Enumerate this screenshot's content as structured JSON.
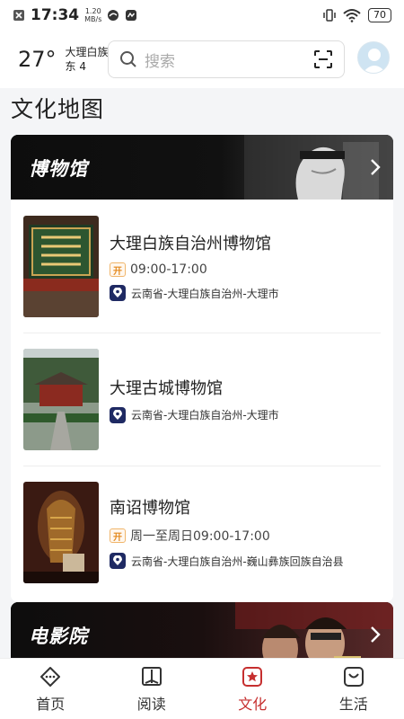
{
  "statusbar": {
    "time": "17:34",
    "net_speed_value": "1.20",
    "net_speed_unit": "MB/s",
    "battery": "70"
  },
  "header": {
    "temperature": "27°",
    "location": "大理白族自治州",
    "wind": "东 4",
    "search_placeholder": "搜索"
  },
  "page_title": "文化地图",
  "sections": [
    {
      "title": "博物馆",
      "items": [
        {
          "name": "大理白族自治州博物馆",
          "badge": "开",
          "hours": "09:00-17:00",
          "address": "云南省-大理白族自治州-大理市"
        },
        {
          "name": "大理古城博物馆",
          "address": "云南省-大理白族自治州-大理市"
        },
        {
          "name": "南诏博物馆",
          "badge": "开",
          "hours": "周一至周日09:00-17:00",
          "address": "云南省-大理白族自治州-巍山彝族回族自治县"
        }
      ]
    },
    {
      "title": "电影院"
    }
  ],
  "tabs": [
    {
      "label": "首页",
      "icon": "home-icon"
    },
    {
      "label": "阅读",
      "icon": "book-icon"
    },
    {
      "label": "文化",
      "icon": "culture-star-icon",
      "active": true
    },
    {
      "label": "生活",
      "icon": "bag-icon"
    }
  ],
  "colors": {
    "accent": "#c62f2f",
    "location_badge": "#1f2a63",
    "open_badge": "#e48a1f"
  }
}
